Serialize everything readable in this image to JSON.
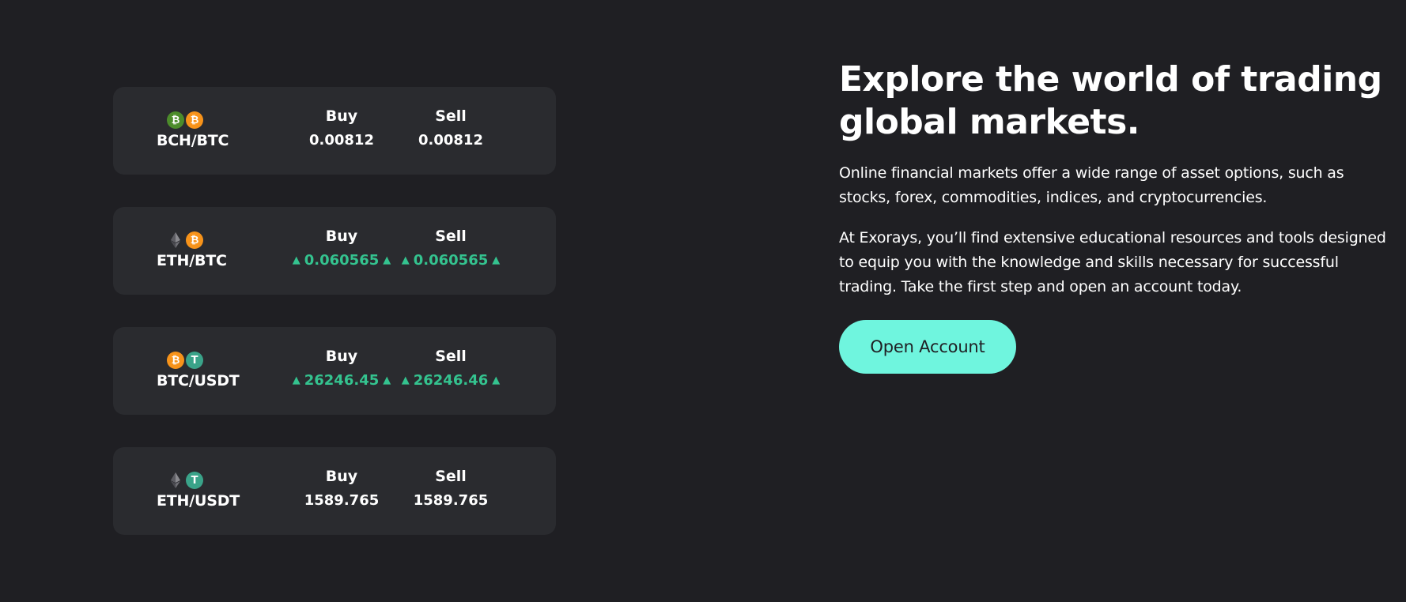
{
  "pairs": [
    {
      "name": "BCH/BTC",
      "icons": [
        {
          "name": "bch-coin-icon",
          "glyph": "₿",
          "class": "bch"
        },
        {
          "name": "btc-coin-icon",
          "glyph": "₿",
          "class": "btc"
        }
      ],
      "buy_label": "Buy",
      "sell_label": "Sell",
      "buy": "0.00812",
      "sell": "0.00812",
      "trend": "neutral"
    },
    {
      "name": "ETH/BTC",
      "icons": [
        {
          "name": "eth-coin-icon",
          "glyph": "",
          "class": "eth"
        },
        {
          "name": "btc-coin-icon",
          "glyph": "₿",
          "class": "btc"
        }
      ],
      "buy_label": "Buy",
      "sell_label": "Sell",
      "buy": "0.060565",
      "sell": "0.060565",
      "trend": "up"
    },
    {
      "name": "BTC/USDT",
      "icons": [
        {
          "name": "btc-coin-icon",
          "glyph": "₿",
          "class": "btc"
        },
        {
          "name": "usdt-coin-icon",
          "glyph": "T",
          "class": "usdt"
        }
      ],
      "buy_label": "Buy",
      "sell_label": "Sell",
      "buy": "26246.45",
      "sell": "26246.46",
      "trend": "up"
    },
    {
      "name": "ETH/USDT",
      "icons": [
        {
          "name": "eth-coin-icon",
          "glyph": "",
          "class": "eth"
        },
        {
          "name": "usdt-coin-icon",
          "glyph": "T",
          "class": "usdt"
        }
      ],
      "buy_label": "Buy",
      "sell_label": "Sell",
      "buy": "1589.765",
      "sell": "1589.765",
      "trend": "neutral"
    }
  ],
  "hero": {
    "headline_line1": "Explore the world of trading",
    "headline_line2": "global markets.",
    "paragraph1": "Online financial markets offer a wide range of asset options, such as stocks, forex, commodities, indices, and cryptocurrencies.",
    "paragraph2": "At Exorays, you’ll find extensive educational resources and tools designed to equip you with the knowledge and skills necessary for successful trading. Take the first step and open an account today.",
    "cta_label": "Open Account"
  },
  "colors": {
    "background": "#1f1f23",
    "card": "#2a2b2f",
    "price_up": "#34c38f",
    "cta": "#6ff5de"
  }
}
